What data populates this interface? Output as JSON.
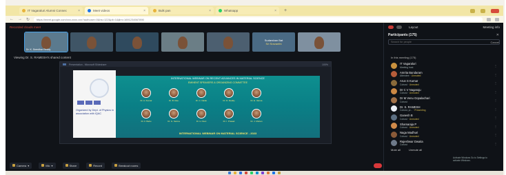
{
  "browser": {
    "tabs": [
      {
        "label": "IT Vagaraluri Alumni Connec",
        "color": "#e8b33a",
        "active": false
      },
      {
        "label": "Meet videos",
        "color": "#1a73e8",
        "active": true
      },
      {
        "label": "Bulk pan",
        "color": "#e8b33a",
        "active": false
      },
      {
        "label": "Whatsapp",
        "color": "#25d366",
        "active": false
      }
    ],
    "new_tab_glyph": "+",
    "url": "https://meet.google.com/xxx-xxxx-xxx?authuser=0&hs=122&pli=1&ijlm=1691234567890"
  },
  "meeting": {
    "title": "Recorded clouds meet",
    "viewing_label": "Viewing Dr. S. RAMESH's shared content",
    "thumbnails": [
      {
        "name": "Dr. K. Sreedhar Reddy",
        "type": "video",
        "bg": "#5b7a8e",
        "self": true
      },
      {
        "name": "",
        "type": "video",
        "bg": "#3f5566",
        "self": false
      },
      {
        "name": "",
        "type": "video",
        "bg": "#2f4a5e",
        "self": false
      },
      {
        "name": "",
        "type": "video",
        "bg": "#6b7e86",
        "self": false
      },
      {
        "name": "",
        "type": "video",
        "bg": "#4c5f70",
        "self": false
      },
      {
        "name": "Sudarshan Bat",
        "caption": "Sri Sravanthi",
        "type": "blank",
        "bg": "#4a6a84",
        "self": false
      },
      {
        "name": "",
        "type": "video",
        "bg": "#7f90a0",
        "self": false
      }
    ]
  },
  "share_toolbar": {
    "title": "Presentation - Microsoft Slideshare",
    "zoom": "100%"
  },
  "slide": {
    "title": "INTERNATIONAL WEBINAR ON RECENT ADVANCES IN MATERIAL SCIENCE",
    "subtitle": "EMINENT SPEAKERS & ORGANIZING COMMITTEE",
    "banner": "INTERNATIONAL WEBINAR ON MATERIAL SCIENCE - 2023",
    "left_text": "Organized by Dept. of Physics in association with IQAC",
    "speakers_row1": [
      "Dr. A. Kumar",
      "Dr. B. Rao",
      "Dr. C. Naidu",
      "Dr. D. Reddy",
      "Dr. E. Varma"
    ],
    "speakers_row2": [
      "Dr. F. Babu",
      "Dr. G. Sarma",
      "Dr. H. Devi",
      "Dr. I. Prasad",
      "Dr. J. Mohan"
    ]
  },
  "panel": {
    "top_label": "Layout",
    "top_right": "Meeting info",
    "heading": "Participants (175)",
    "close": "✕",
    "search_placeholder": "Search for people",
    "cancel": "Cancel",
    "section": "In this meeting (175)",
    "participants": [
      {
        "name": "IT Vagaraluri",
        "role": "Meeting host",
        "warn": "",
        "color": "#c9913e"
      },
      {
        "name": "Amrita Bandaram",
        "role": "Attendee",
        "warn": "Unmuted",
        "color": "#b65c3a"
      },
      {
        "name": "Arun S Kumar",
        "role": "Cohost",
        "warn": "Unmuted",
        "color": "#8a6a3a"
      },
      {
        "name": "Dr C V Nagaraju",
        "role": "Cohost",
        "warn": "Unmuted",
        "color": "#cc8844"
      },
      {
        "name": "Dr M Venu Gopalachari",
        "role": "Cohost",
        "warn": "",
        "color": "#a07048"
      },
      {
        "name": "Dr. S. RAMESH",
        "role": "Cohost, pr...",
        "warn": "Presenting",
        "color": "#e9eef5"
      },
      {
        "name": "Ganesh B",
        "role": "Cohost",
        "warn": "Unmuted",
        "color": "#5b6e82"
      },
      {
        "name": "Shamaraja P",
        "role": "Cohost",
        "warn": "Unmuted",
        "color": "#d08a4a"
      },
      {
        "name": "Naga Madhuri",
        "role": "Cohost",
        "warn": "Unmuted",
        "color": "#8a5a38"
      },
      {
        "name": "Rajeshwar Dwaita",
        "role": "Cohost",
        "warn": "",
        "color": "#6e7a8a"
      }
    ],
    "footer": [
      "Mute all",
      "Unmute all"
    ],
    "note": "Activate Windows Go to Settings to activate Windows."
  },
  "controls": {
    "items": [
      {
        "label": "Camera",
        "dropdown": "▾"
      },
      {
        "label": "Mic",
        "dropdown": "▾"
      },
      {
        "label": "Share",
        "dropdown": ""
      },
      {
        "label": "Record",
        "dropdown": ""
      },
      {
        "label": "Breakout rooms",
        "dropdown": ""
      }
    ],
    "leave_label": "Leave"
  },
  "taskbar_icons": [
    "#3a7bd5",
    "#e8b33a",
    "#2f6fe0",
    "#d64a3a",
    "#25d366",
    "#0a8fd1",
    "#7b3fd6",
    "#e07b39",
    "#1a73e8",
    "#c8a040"
  ]
}
